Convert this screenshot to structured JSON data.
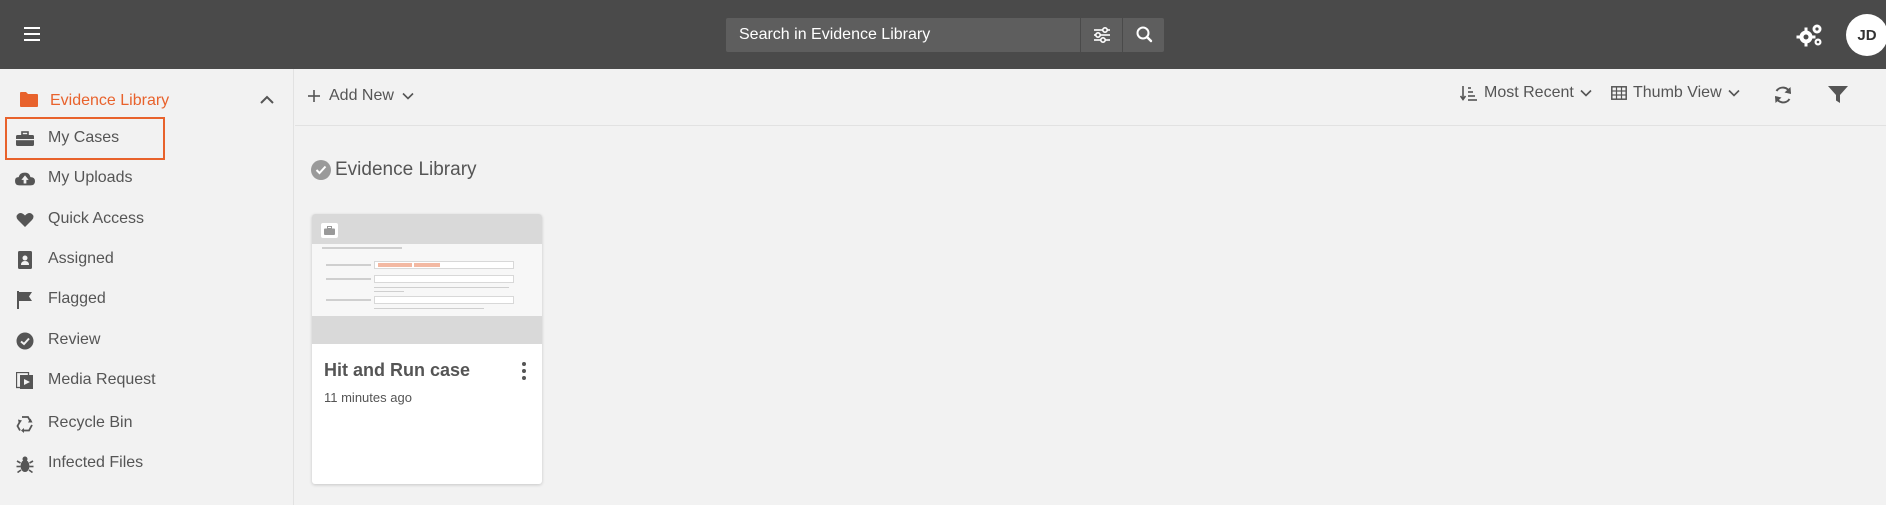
{
  "search": {
    "placeholder": "Search in Evidence Library"
  },
  "user": {
    "initials": "JD"
  },
  "sidebar": {
    "library_title": "Evidence Library",
    "items": [
      {
        "label": "My Cases",
        "icon": "briefcase-icon",
        "active": true
      },
      {
        "label": "My Uploads",
        "icon": "cloud-upload-icon"
      },
      {
        "label": "Quick Access",
        "icon": "heart-icon"
      },
      {
        "label": "Assigned",
        "icon": "id-badge-icon"
      },
      {
        "label": "Flagged",
        "icon": "flag-icon"
      },
      {
        "label": "Review",
        "icon": "check-circle-icon"
      },
      {
        "label": "Media Request",
        "icon": "media-request-icon"
      },
      {
        "label": "Recycle Bin",
        "icon": "recycle-icon"
      },
      {
        "label": "Infected Files",
        "icon": "bug-icon"
      }
    ]
  },
  "toolbar": {
    "add_new": "Add New",
    "sort": "Most Recent",
    "view": "Thumb View"
  },
  "content": {
    "section_title": "Evidence Library",
    "cards": [
      {
        "title": "Hit and Run case",
        "time": "11 minutes ago"
      }
    ]
  },
  "colors": {
    "accent": "#e8622c",
    "topbar": "#4a4a4a"
  }
}
